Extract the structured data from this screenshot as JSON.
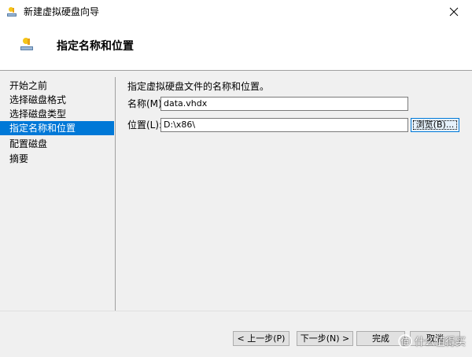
{
  "window": {
    "title": "新建虚拟硬盘向导",
    "close_label": "关闭"
  },
  "header": {
    "title": "指定名称和位置"
  },
  "sidebar": {
    "items": [
      {
        "label": "开始之前"
      },
      {
        "label": "选择磁盘格式"
      },
      {
        "label": "选择磁盘类型"
      },
      {
        "label": "指定名称和位置"
      },
      {
        "label": "配置磁盘"
      },
      {
        "label": "摘要"
      }
    ],
    "selected_index": 3
  },
  "content": {
    "description": "指定虚拟硬盘文件的名称和位置。",
    "name_label": "名称(M):",
    "name_value": "data.vhdx",
    "location_label": "位置(L):",
    "location_value": "D:\\x86\\",
    "browse_label": "浏览(B)..."
  },
  "footer": {
    "prev_label": "< 上一步(P)",
    "next_label": "下一步(N) >",
    "finish_label": "完成",
    "cancel_label": "取消"
  },
  "watermark": {
    "text": "什么值得买"
  },
  "colors": {
    "selection": "#0078d7",
    "background": "#f0f0f0",
    "header_bg": "#ffffff"
  }
}
